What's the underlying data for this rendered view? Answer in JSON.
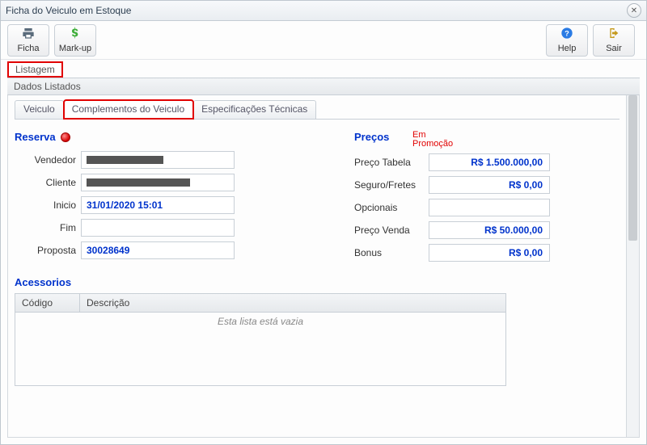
{
  "window": {
    "title": "Ficha do Veiculo em Estoque"
  },
  "toolbar": {
    "ficha": "Ficha",
    "markup": "Mark-up",
    "help": "Help",
    "sair": "Sair"
  },
  "nav": {
    "listagem": "Listagem"
  },
  "section": {
    "dados_listados": "Dados Listados"
  },
  "tabs": {
    "veiculo": "Veiculo",
    "complementos": "Complementos do Veiculo",
    "especificacoes": "Especificações Técnicas"
  },
  "reserva": {
    "title": "Reserva",
    "labels": {
      "vendedor": "Vendedor",
      "cliente": "Cliente",
      "inicio": "Inicio",
      "fim": "Fim",
      "proposta": "Proposta"
    },
    "values": {
      "inicio": "31/01/2020 15:01",
      "fim": "",
      "proposta": "30028649"
    }
  },
  "precos": {
    "title": "Preços",
    "promo": "Em Promoção",
    "labels": {
      "tabela": "Preço Tabela",
      "seguro": "Seguro/Fretes",
      "opcionais": "Opcionais",
      "venda": "Preço Venda",
      "bonus": "Bonus"
    },
    "values": {
      "tabela": "R$ 1.500.000,00",
      "seguro": "R$ 0,00",
      "opcionais": "",
      "venda": "R$ 50.000,00",
      "bonus": "R$ 0,00"
    }
  },
  "acessorios": {
    "title": "Acessorios",
    "columns": {
      "codigo": "Código",
      "descricao": "Descrição"
    },
    "empty": "Esta lista está vazia"
  }
}
